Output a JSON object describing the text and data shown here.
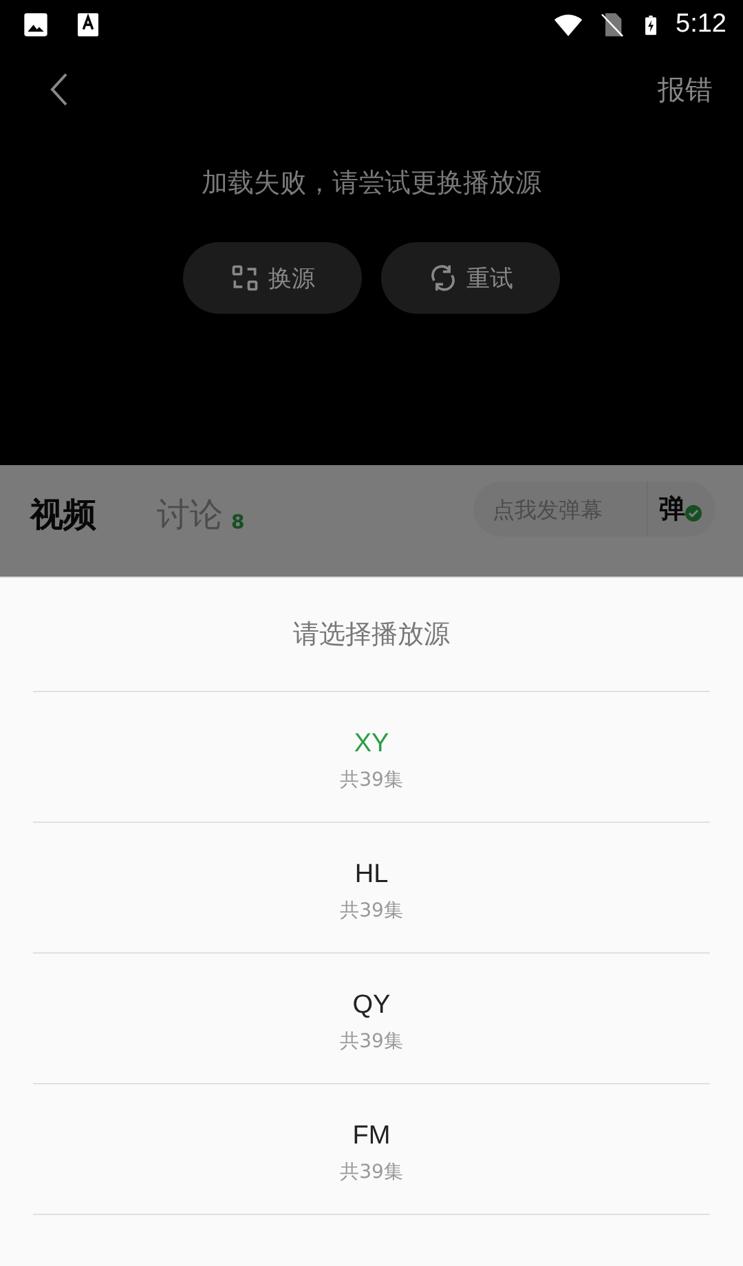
{
  "status_bar": {
    "time": "5:12"
  },
  "player": {
    "report": "报错",
    "message": "加载失败，请尝试更换播放源",
    "buttons": [
      {
        "kind": "switch",
        "label": "换源"
      },
      {
        "kind": "retry",
        "label": "重试"
      }
    ]
  },
  "tabs": [
    {
      "label": "视频",
      "selected": true
    },
    {
      "label": "讨论",
      "selected": false,
      "badge": "8"
    }
  ],
  "danmaku": {
    "placeholder": "点我发弹幕",
    "toggle": "弹",
    "on": true
  },
  "sheet": {
    "title": "请选择播放源",
    "sources": [
      {
        "name": "XY",
        "count": "共39集",
        "selected": true
      },
      {
        "name": "HL",
        "count": "共39集",
        "selected": false
      },
      {
        "name": "QY",
        "count": "共39集",
        "selected": false
      },
      {
        "name": "FM",
        "count": "共39集",
        "selected": false
      }
    ]
  }
}
